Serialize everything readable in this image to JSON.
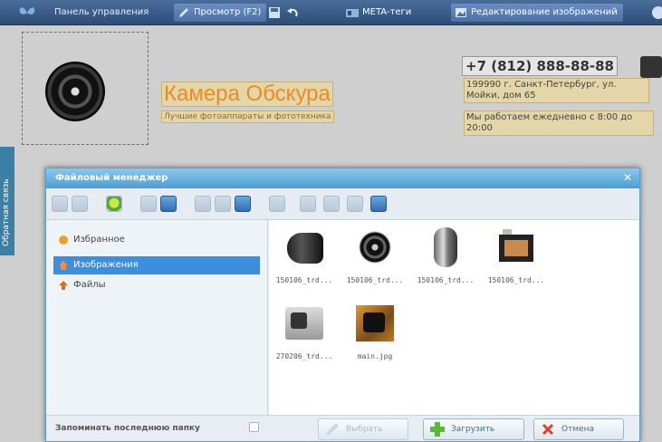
{
  "admin_bar": {
    "panel_label": "Панель управления",
    "preview_label": "Просмотр (F2)",
    "meta_label": "META-теги",
    "image_edit_label": "Редактирование изображений"
  },
  "site": {
    "brand_name": "Камера Обскура",
    "brand_tagline": "Лучшие фотоаппараты и фототехника",
    "phone": "+7 (812) 888-88-88",
    "address": "199990 г. Санкт-Петербург, ул. Мойки, дом 65",
    "hours": "Мы работаем ежедневно с 8:00 до 20:00",
    "side_tab": "Обратная связь"
  },
  "dialog": {
    "title": "Файловый менеджер",
    "close_glyph": "✕",
    "folders": [
      {
        "label": "Избранное",
        "icon": "star-icon",
        "selected": false
      },
      {
        "label": "Изображения",
        "icon": "home-icon",
        "selected": true
      },
      {
        "label": "Файлы",
        "icon": "upload-icon",
        "selected": false
      }
    ],
    "files": [
      {
        "name": "150106_trd...",
        "icon": "lens-side-thumb"
      },
      {
        "name": "150106_trd...",
        "icon": "lens-front-thumb"
      },
      {
        "name": "150106_trd...",
        "icon": "lens-long-thumb"
      },
      {
        "name": "150106_trd...",
        "icon": "camera-body-thumb"
      },
      {
        "name": "270206_trd...",
        "icon": "compact-camera-thumb"
      },
      {
        "name": "main.jpg",
        "icon": "photo-thumb"
      }
    ],
    "remember_label": "Запоминать последнюю папку",
    "select_label": "Выбрать",
    "upload_label": "Загрузить",
    "cancel_label": "Отмена"
  }
}
